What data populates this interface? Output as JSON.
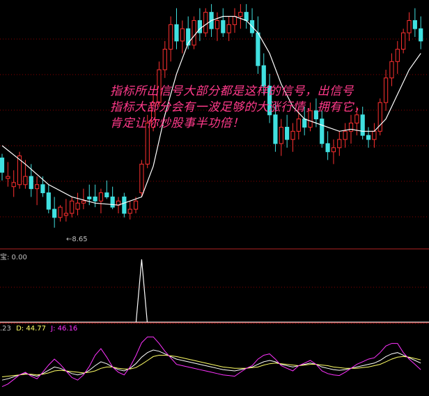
{
  "main_panel": {
    "low_marker": "8.65",
    "candles": [
      [
        -1,
        0.86,
        1.07,
        0.88,
        1.01
      ],
      [
        0,
        0.99,
        1.01,
        0.88,
        0.92
      ],
      [
        1,
        0.89,
        0.97,
        0.85,
        0.9
      ],
      [
        2,
        0.85,
        0.93,
        0.8,
        0.87
      ],
      [
        3,
        0.86,
        1.02,
        0.84,
        1.0
      ],
      [
        4,
        0.86,
        0.98,
        0.84,
        0.9
      ],
      [
        5,
        0.9,
        0.96,
        0.8,
        0.84
      ],
      [
        6,
        0.84,
        0.9,
        0.76,
        0.86
      ],
      [
        7,
        0.86,
        0.9,
        0.8,
        0.82
      ],
      [
        8,
        0.82,
        0.86,
        0.72,
        0.74
      ],
      [
        9,
        0.74,
        0.8,
        0.65,
        0.7
      ],
      [
        10,
        0.7,
        0.76,
        0.68,
        0.75
      ],
      [
        11,
        0.71,
        0.79,
        0.68,
        0.72
      ],
      [
        12,
        0.72,
        0.8,
        0.7,
        0.78
      ],
      [
        13,
        0.74,
        0.82,
        0.71,
        0.77
      ],
      [
        14,
        0.77,
        0.84,
        0.74,
        0.78
      ],
      [
        15,
        0.8,
        0.86,
        0.76,
        0.79
      ],
      [
        16,
        0.8,
        0.86,
        0.75,
        0.78
      ],
      [
        17,
        0.78,
        0.84,
        0.72,
        0.82
      ],
      [
        18,
        0.82,
        0.88,
        0.79,
        0.8
      ],
      [
        19,
        0.8,
        0.85,
        0.74,
        0.75
      ],
      [
        20,
        0.76,
        0.8,
        0.72,
        0.78
      ],
      [
        21,
        0.8,
        0.82,
        0.7,
        0.72
      ],
      [
        22,
        0.72,
        0.78,
        0.69,
        0.74
      ],
      [
        23,
        0.74,
        0.8,
        0.72,
        0.78
      ],
      [
        24,
        0.82,
        0.98,
        0.8,
        0.96
      ],
      [
        25,
        0.96,
        1.2,
        0.94,
        1.16
      ],
      [
        26,
        1.14,
        1.3,
        1.12,
        1.26
      ],
      [
        27,
        1.26,
        1.46,
        1.24,
        1.42
      ],
      [
        28,
        1.42,
        1.56,
        1.38,
        1.52
      ],
      [
        29,
        1.52,
        1.68,
        1.46,
        1.64
      ],
      [
        30,
        1.64,
        1.72,
        1.52,
        1.56
      ],
      [
        31,
        1.56,
        1.66,
        1.5,
        1.62
      ],
      [
        32,
        1.62,
        1.68,
        1.52,
        1.54
      ],
      [
        33,
        1.54,
        1.68,
        1.52,
        1.66
      ],
      [
        34,
        1.66,
        1.72,
        1.56,
        1.6
      ],
      [
        35,
        1.6,
        1.72,
        1.58,
        1.7
      ],
      [
        36,
        1.7,
        1.74,
        1.58,
        1.62
      ],
      [
        37,
        1.62,
        1.7,
        1.56,
        1.66
      ],
      [
        38,
        1.66,
        1.72,
        1.58,
        1.6
      ],
      [
        39,
        1.6,
        1.68,
        1.56,
        1.64
      ],
      [
        40,
        1.64,
        1.72,
        1.6,
        1.68
      ],
      [
        41,
        1.68,
        1.74,
        1.62,
        1.7
      ],
      [
        42,
        1.7,
        1.74,
        1.62,
        1.66
      ],
      [
        43,
        1.66,
        1.72,
        1.58,
        1.6
      ],
      [
        44,
        1.6,
        1.68,
        1.4,
        1.44
      ],
      [
        45,
        1.44,
        1.5,
        1.3,
        1.34
      ],
      [
        46,
        1.34,
        1.4,
        1.16,
        1.2
      ],
      [
        47,
        1.2,
        1.26,
        1.02,
        1.06
      ],
      [
        48,
        1.06,
        1.18,
        1.0,
        1.14
      ],
      [
        49,
        1.14,
        1.2,
        1.04,
        1.08
      ],
      [
        50,
        1.08,
        1.16,
        1.02,
        1.12
      ],
      [
        51,
        1.12,
        1.22,
        1.08,
        1.18
      ],
      [
        52,
        1.18,
        1.24,
        1.1,
        1.14
      ],
      [
        53,
        1.14,
        1.26,
        1.12,
        1.22
      ],
      [
        54,
        1.22,
        1.28,
        1.14,
        1.18
      ],
      [
        55,
        1.18,
        1.22,
        1.04,
        1.06
      ],
      [
        56,
        1.06,
        1.12,
        0.98,
        1.02
      ],
      [
        57,
        1.02,
        1.08,
        0.96,
        1.04
      ],
      [
        58,
        1.04,
        1.12,
        1.0,
        1.08
      ],
      [
        59,
        1.08,
        1.16,
        1.04,
        1.12
      ],
      [
        60,
        1.12,
        1.2,
        1.06,
        1.16
      ],
      [
        61,
        1.16,
        1.24,
        1.1,
        1.2
      ],
      [
        62,
        1.2,
        1.24,
        1.08,
        1.1
      ],
      [
        63,
        1.1,
        1.14,
        1.04,
        1.08
      ],
      [
        64,
        1.08,
        1.16,
        1.04,
        1.12
      ],
      [
        65,
        1.12,
        1.28,
        1.1,
        1.26
      ],
      [
        66,
        1.26,
        1.42,
        1.22,
        1.38
      ],
      [
        67,
        1.38,
        1.5,
        1.34,
        1.46
      ],
      [
        68,
        1.46,
        1.56,
        1.4,
        1.52
      ],
      [
        69,
        1.52,
        1.62,
        1.5,
        1.6
      ],
      [
        70,
        1.6,
        1.7,
        1.56,
        1.66
      ],
      [
        71,
        1.66,
        1.72,
        1.58,
        1.62
      ],
      [
        72,
        1.62,
        1.68,
        1.52,
        1.56
      ]
    ],
    "ma_points": [
      [
        0,
        1.05
      ],
      [
        4,
        0.96
      ],
      [
        8,
        0.86
      ],
      [
        12,
        0.8
      ],
      [
        16,
        0.77
      ],
      [
        20,
        0.76
      ],
      [
        24,
        0.8
      ],
      [
        26,
        0.95
      ],
      [
        28,
        1.2
      ],
      [
        30,
        1.4
      ],
      [
        32,
        1.55
      ],
      [
        34,
        1.62
      ],
      [
        36,
        1.66
      ],
      [
        38,
        1.68
      ],
      [
        40,
        1.68
      ],
      [
        42,
        1.66
      ],
      [
        44,
        1.6
      ],
      [
        46,
        1.5
      ],
      [
        48,
        1.35
      ],
      [
        50,
        1.24
      ],
      [
        52,
        1.18
      ],
      [
        54,
        1.16
      ],
      [
        56,
        1.14
      ],
      [
        58,
        1.12
      ],
      [
        60,
        1.13
      ],
      [
        62,
        1.12
      ],
      [
        64,
        1.12
      ],
      [
        66,
        1.18
      ],
      [
        68,
        1.3
      ],
      [
        70,
        1.42
      ],
      [
        72,
        1.5
      ]
    ]
  },
  "signal_panel": {
    "label": "宝: 0.00",
    "spike_index": 24
  },
  "kdj_panel": {
    "k_label": ".23",
    "d_label": "D: 44.77",
    "j_label": "J: 46.16",
    "k_color": "#ffffff",
    "d_color": "#ffff66",
    "j_color": "#ff33ff",
    "k_series": [
      20,
      22,
      25,
      28,
      30,
      28,
      26,
      30,
      35,
      40,
      38,
      34,
      30,
      28,
      30,
      35,
      42,
      48,
      45,
      40,
      36,
      34,
      38,
      45,
      55,
      62,
      66,
      64,
      60,
      56,
      52,
      50,
      48,
      46,
      44,
      42,
      40,
      38,
      36,
      35,
      34,
      36,
      38,
      40,
      44,
      48,
      50,
      48,
      44,
      42,
      40,
      42,
      44,
      46,
      44,
      40,
      38,
      36,
      35,
      36,
      38,
      40,
      42,
      44,
      46,
      50,
      56,
      60,
      62,
      58,
      54,
      50,
      46
    ],
    "d_series": [
      25,
      26,
      27,
      28,
      29,
      29,
      28,
      29,
      31,
      34,
      35,
      34,
      33,
      32,
      31,
      32,
      34,
      38,
      40,
      40,
      38,
      37,
      37,
      39,
      44,
      50,
      56,
      58,
      58,
      57,
      56,
      54,
      52,
      50,
      48,
      46,
      44,
      42,
      40,
      39,
      38,
      38,
      38,
      39,
      40,
      43,
      45,
      46,
      45,
      44,
      43,
      42,
      43,
      44,
      44,
      43,
      42,
      40,
      39,
      38,
      38,
      38,
      39,
      40,
      42,
      44,
      48,
      52,
      55,
      56,
      55,
      53,
      51
    ],
    "j_series": [
      10,
      14,
      21,
      28,
      32,
      26,
      22,
      32,
      43,
      52,
      44,
      34,
      24,
      20,
      28,
      41,
      58,
      68,
      55,
      40,
      32,
      28,
      40,
      57,
      77,
      86,
      86,
      76,
      64,
      54,
      44,
      42,
      40,
      38,
      36,
      34,
      32,
      30,
      28,
      27,
      26,
      32,
      38,
      42,
      52,
      58,
      60,
      52,
      42,
      38,
      34,
      42,
      46,
      50,
      44,
      34,
      30,
      28,
      27,
      32,
      38,
      44,
      48,
      52,
      54,
      62,
      72,
      76,
      76,
      62,
      52,
      44,
      36
    ]
  },
  "overlay_text": {
    "line1": "指标所出信号大部分都是这样的信号，出信号",
    "line2": "指标大部分会有一波足够的大涨行情，拥有它，",
    "line3": "肯定让你炒股事半功倍！"
  },
  "colors": {
    "up": "#ff3030",
    "down": "#40e0e0",
    "ma": "#ffffff",
    "grid": "#8b0000",
    "separator": "#b22222",
    "label_text": "#c0c0c0"
  }
}
